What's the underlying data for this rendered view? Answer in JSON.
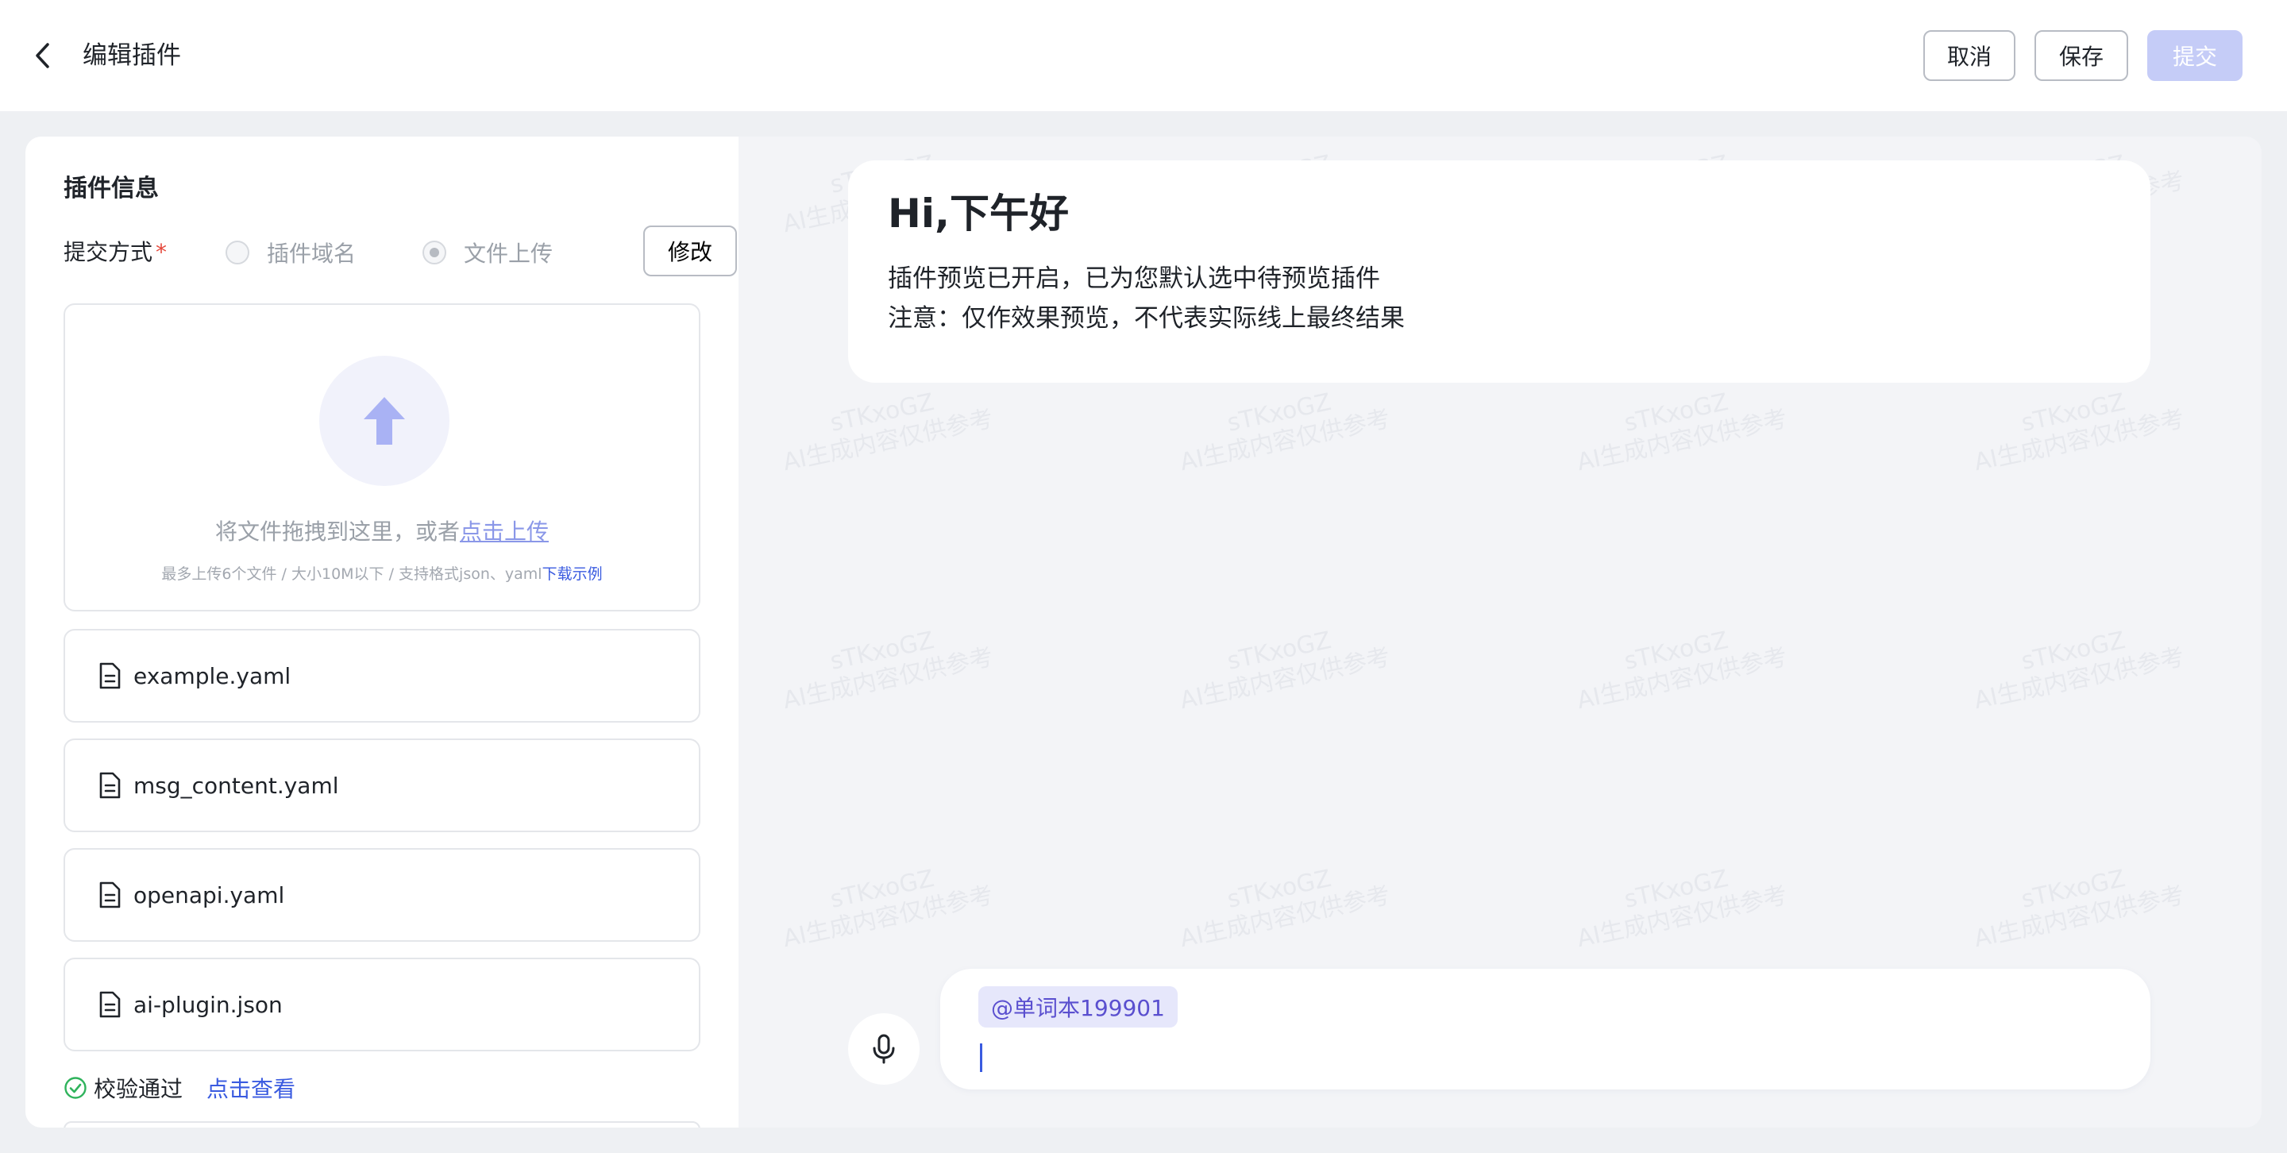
{
  "header": {
    "title": "编辑插件",
    "cancel_label": "取消",
    "save_label": "保存",
    "submit_label": "提交"
  },
  "plugin_info": {
    "section_title": "插件信息",
    "submit_method_label": "提交方式",
    "required_mark": "*",
    "options": [
      {
        "label": "插件域名",
        "selected": false
      },
      {
        "label": "文件上传",
        "selected": true
      }
    ],
    "modify_label": "修改"
  },
  "upload": {
    "text": "将文件拖拽到这里，或者",
    "link": "点击上传",
    "hint": "最多上传6个文件 / 大小10M以下 / 支持格式json、yaml",
    "hint_link": "下载示例"
  },
  "files": [
    {
      "name": "example.yaml"
    },
    {
      "name": "msg_content.yaml"
    },
    {
      "name": "openapi.yaml"
    },
    {
      "name": "ai-plugin.json"
    }
  ],
  "verify": {
    "status": "校验通过",
    "link": "点击查看"
  },
  "preview": {
    "greeting": "Hi,下午好",
    "line1": "插件预览已开启，已为您默认选中待预览插件",
    "line2": "注意：仅作效果预览，不代表实际线上最终结果"
  },
  "chat_input": {
    "mention": "@单词本199901"
  },
  "watermark": {
    "line1": "sTKxoGZ",
    "line2": "AI生成内容仅供参考"
  },
  "colors": {
    "accent": "#3a5be0",
    "submit_disabled": "#c5ccf7",
    "mention_bg": "#e6e7fb",
    "success": "#2fb35c"
  }
}
